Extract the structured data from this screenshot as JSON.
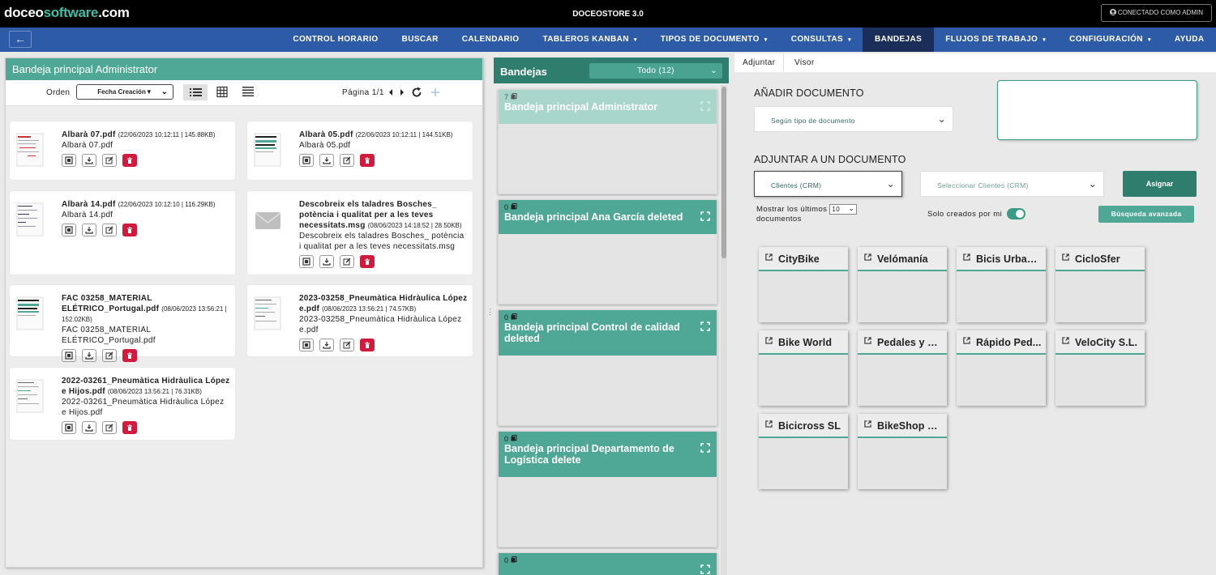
{
  "topbar": {
    "logo_part1": "doceo",
    "logo_part2": "software",
    "logo_part3": ".com",
    "app_title": "DOCEOSTORE 3.0",
    "connection": "CONECTADO COMO ADMIN"
  },
  "nav": {
    "back_icon": "arrow-left-icon",
    "items": [
      {
        "label": "CONTROL HORARIO",
        "dropdown": false
      },
      {
        "label": "BUSCAR",
        "dropdown": false
      },
      {
        "label": "CALENDARIO",
        "dropdown": false
      },
      {
        "label": "TABLEROS KANBAN",
        "dropdown": true
      },
      {
        "label": "TIPOS DE DOCUMENTO",
        "dropdown": true
      },
      {
        "label": "CONSULTAS",
        "dropdown": true
      },
      {
        "label": "BANDEJAS",
        "dropdown": false,
        "active": true
      },
      {
        "label": "FLUJOS DE TRABAJO",
        "dropdown": true
      },
      {
        "label": "CONFIGURACIÓN",
        "dropdown": true
      },
      {
        "label": "AYUDA",
        "dropdown": false
      }
    ],
    "caret": "▾"
  },
  "left_panel": {
    "title": "Bandeja principal Administrator",
    "order_label": "Orden",
    "order_value": "Fecha Creación",
    "order_caret": "▼",
    "page_info": "Página 1/1",
    "documents": [
      {
        "name": "Albarà 07.pdf",
        "meta": "(22/06/2023 10:12:11 | 145.88KB)",
        "desc": "Albarà 07.pdf",
        "thumb": "pdf-thumbnail-red"
      },
      {
        "name": "Albarà 05.pdf",
        "meta": "(22/06/2023 10:12:11 | 144.51KB)",
        "desc": "Albarà 05.pdf",
        "thumb": "pdf-thumbnail-green"
      },
      {
        "name": "Albarà 14.pdf",
        "meta": "(22/06/2023 10:12:10 | 116.29KB)",
        "desc": "Albarà 14.pdf",
        "thumb": "pdf-thumbnail-blue"
      },
      {
        "name": "Descobreix els taladres Bosches_ potència i qualitat per a les teves necessitats.msg",
        "meta": "(08/06/2023 14:18:52 | 28.50KB)",
        "desc": "Descobreix els taladres Bosches_ potència i qualitat per a les teves necessitats.msg",
        "thumb": "envelope-icon"
      },
      {
        "name": "FAC 03258_MATERIAL ELÉTRICO_Portugal.pdf",
        "meta": "(08/06/2023 13:56:21 | 152.02KB)",
        "desc": "FAC 03258_MATERIAL ELÉTRICO_Portugal.pdf",
        "thumb": "pdf-thumbnail-green"
      },
      {
        "name": "2023-03258_Pneumàtica Hidràulica López e.pdf",
        "meta": "(08/06/2023 13:56:21 | 74.57KB)",
        "desc": "2023-03258_Pneumàtica Hidràulica López e.pdf",
        "thumb": "pdf-thumbnail-gray"
      },
      {
        "name": "2022-03261_Pneumàtica Hidràulica López e Hijos.pdf",
        "meta": "(08/06/2023 13:56:21 | 76.31KB)",
        "desc": "2022-03261_Pneumàtica Hidràulica López e Hijos.pdf",
        "thumb": "pdf-thumbnail-gray"
      }
    ]
  },
  "mid_panel": {
    "title": "Bandejas",
    "filter": "Todo (12)",
    "filter_caret": "⌄",
    "trays": [
      {
        "count": "7",
        "name": "Bandeja principal Administrator",
        "current": true
      },
      {
        "count": "0",
        "name": "Bandeja principal Ana García deleted"
      },
      {
        "count": "0",
        "name": "Bandeja principal Control de calidad deleted"
      },
      {
        "count": "0",
        "name": "Bandeja principal Departamento de Logística delete"
      },
      {
        "count": "0",
        "name": ""
      }
    ]
  },
  "right_panel": {
    "tabs": [
      "Adjuntar",
      "Visor"
    ],
    "add_title": "AÑADIR DOCUMENTO",
    "doc_type_select": "Según tipo de documento",
    "attach_title": "ADJUNTAR A UN DOCUMENTO",
    "entity_select": "Clientes (CRM)",
    "record_select": "Seleccionar Clientes (CRM)",
    "assign_button": "Asignar",
    "show_last_pre": "Mostrar los últimos",
    "show_last_value": "10",
    "show_last_post": "documentos",
    "only_mine": "Solo creados por mi",
    "only_mine_on": true,
    "advanced_button": "Búsqueda avanzada",
    "clients": [
      "CityBike",
      "Velómanía",
      "Bicis Urbanas",
      "CicloSfer",
      "Bike World",
      "Pedales y M...",
      "Rápido Ped...",
      "VeloCity S.L.",
      "Bicicross SL",
      "BikeShop S.A."
    ]
  },
  "colors": {
    "topbar": "#000000",
    "navbar": "#2e5ba8",
    "nav_active": "#1a2e59",
    "teal": "#4fa895",
    "dark_teal": "#2f7d6d",
    "delete_red": "#d11a3c"
  }
}
